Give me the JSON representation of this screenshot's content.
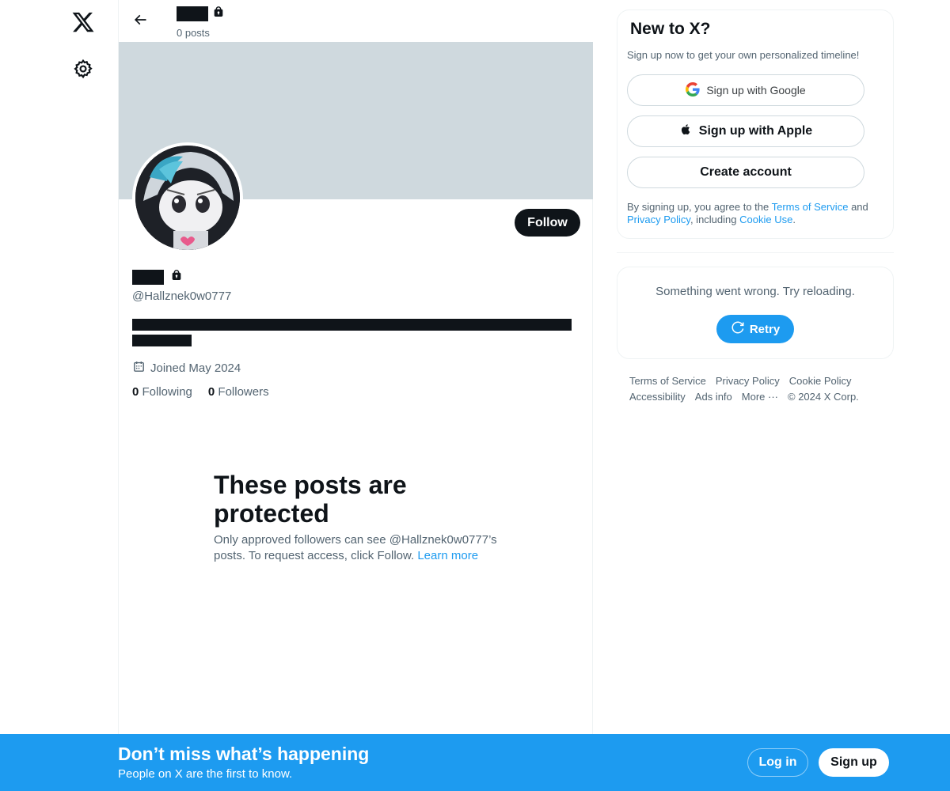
{
  "nav": {
    "logo_icon": "x-logo-icon",
    "settings_icon": "gear-icon"
  },
  "header": {
    "posts_count": "0 posts",
    "back_icon": "arrow-left-icon",
    "lock_icon": "lock-icon"
  },
  "profile": {
    "handle": "@Hallznek0w0777",
    "follow_label": "Follow",
    "joined": "Joined May 2024",
    "following_count": "0",
    "following_label": "Following",
    "followers_count": "0",
    "followers_label": "Followers"
  },
  "protected": {
    "title": "These posts are protected",
    "body": "Only approved followers can see @Hallznek0w0777’s posts. To request access, click Follow.",
    "learn_more": "Learn more"
  },
  "signup_panel": {
    "title": "New to X?",
    "subtitle": "Sign up now to get your own personalized timeline!",
    "google_label": "Sign up with Google",
    "apple_label": "Sign up with Apple",
    "create_label": "Create account",
    "terms_prefix": "By signing up, you agree to the",
    "terms_link": "Terms of Service",
    "terms_and": "and",
    "privacy_link": "Privacy Policy",
    "including": ", including",
    "cookie_link": "Cookie Use",
    "period": "."
  },
  "error_panel": {
    "message": "Something went wrong. Try reloading.",
    "retry_label": "Retry"
  },
  "footer": {
    "links": [
      "Terms of Service",
      "Privacy Policy",
      "Cookie Policy",
      "Accessibility",
      "Ads info",
      "More ···",
      "© 2024 X Corp."
    ]
  },
  "bottom_bar": {
    "title": "Don’t miss what’s happening",
    "subtitle": "People on X are the first to know.",
    "login_label": "Log in",
    "signup_label": "Sign up"
  },
  "colors": {
    "accent": "#1d9bf0",
    "banner": "#cfd9de",
    "text_primary": "#0f1419",
    "text_secondary": "#536471"
  }
}
